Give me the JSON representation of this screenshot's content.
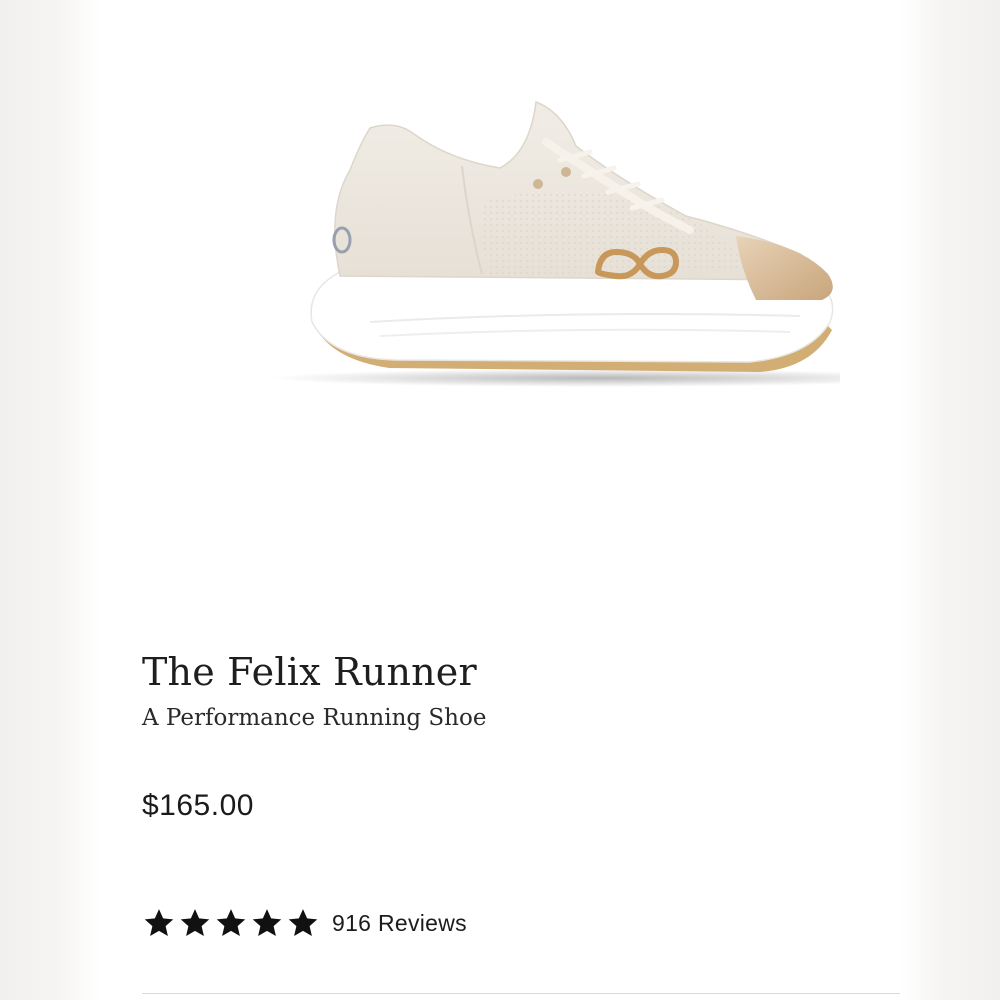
{
  "product": {
    "name": "The Felix Runner",
    "subtitle": "A Performance Running Shoe",
    "price": "$165.00",
    "rating": {
      "stars": 5,
      "max_stars": 5,
      "reviews_label": "916 Reviews",
      "star_icon": "star-icon"
    },
    "image": {
      "icon": "running-shoe-image",
      "colors": {
        "upper": "#ece7df",
        "midsole": "#ffffff",
        "outsole": "#d2ad74",
        "toe_cap": "#d6ba96",
        "logo": "#c8975a"
      }
    }
  },
  "theme": {
    "text": "#1e1e1e",
    "star": "#111111",
    "background": "#ffffff",
    "margin_background": "#f3f2f0"
  }
}
